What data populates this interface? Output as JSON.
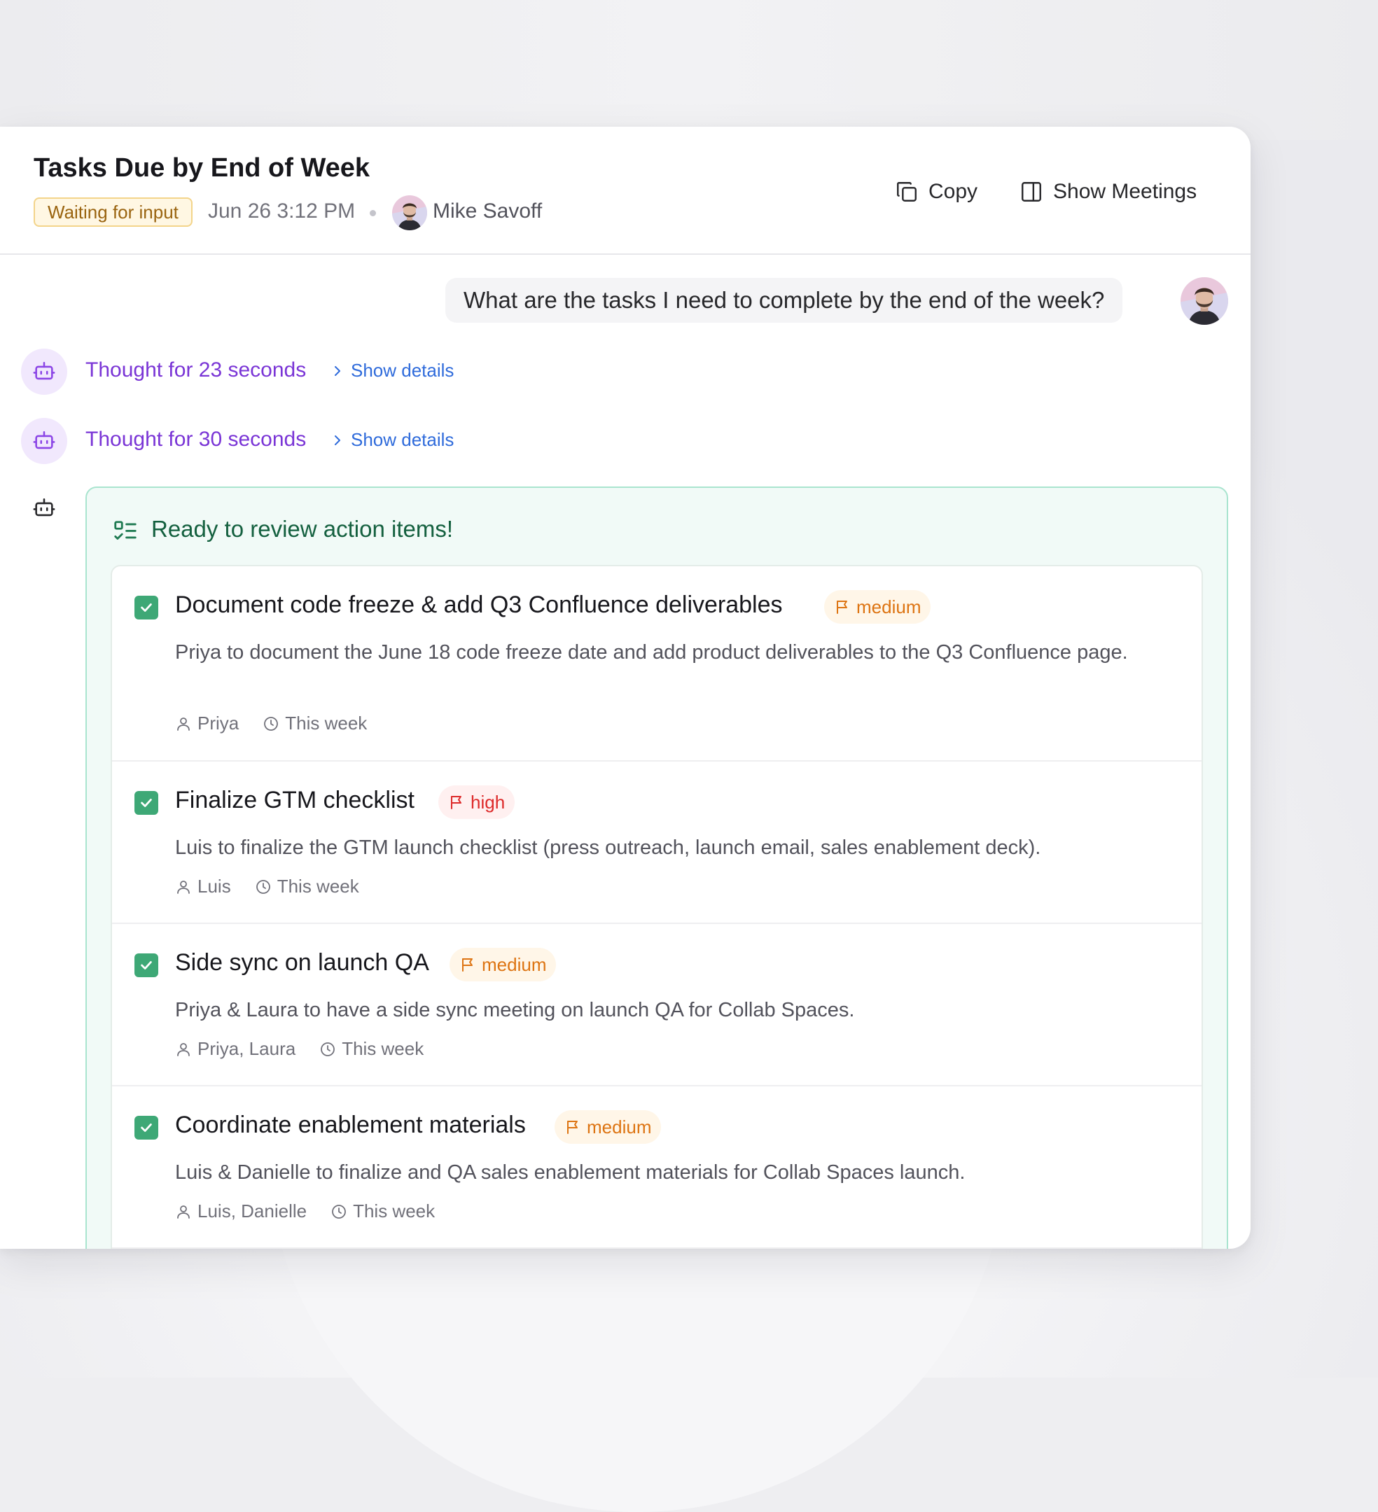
{
  "header": {
    "title": "Tasks Due by End of Week",
    "status": "Waiting for input",
    "date": "Jun 26 3:12 PM",
    "user_name": "Mike Savoff",
    "copy_label": "Copy",
    "show_meetings_label": "Show Meetings"
  },
  "conversation": {
    "user_message": "What are the tasks I need to complete by the end of the week?",
    "thoughts": [
      {
        "label": "Thought for 23 seconds",
        "link": "Show details"
      },
      {
        "label": "Thought for 30 seconds",
        "link": "Show details"
      }
    ]
  },
  "action_items": {
    "heading": "Ready to review action items!",
    "items": [
      {
        "title": "Document code freeze & add Q3 Confluence deliverables",
        "priority": "medium",
        "description": "Priya to document the June 18 code freeze date and add product deliverables to the Q3 Confluence page.",
        "assignees": "Priya",
        "due": "This week",
        "checked": true
      },
      {
        "title": "Finalize GTM checklist",
        "priority": "high",
        "description": "Luis to finalize the GTM launch checklist (press outreach, launch email, sales enablement deck).",
        "assignees": "Luis",
        "due": "This week",
        "checked": true
      },
      {
        "title": "Side sync on launch QA",
        "priority": "medium",
        "description": "Priya & Laura to have a side sync meeting on launch QA for Collab Spaces.",
        "assignees": "Priya, Laura",
        "due": "This week",
        "checked": true
      },
      {
        "title": "Coordinate enablement materials",
        "priority": "medium",
        "description": "Luis & Danielle to finalize and QA sales enablement materials for Collab Spaces launch.",
        "assignees": "Luis, Danielle",
        "due": "This week",
        "checked": true
      }
    ]
  },
  "colors": {
    "accent_purple": "#7a35d6",
    "link_blue": "#2f6bdb",
    "success_green": "#3ea876",
    "priority_medium": "#dd7412",
    "priority_high": "#dd2a2a",
    "status_amber": "#9a6410"
  },
  "icons": {
    "copy": "copy-icon",
    "meetings": "sidebar-panel-icon",
    "bot": "robot-icon",
    "checklist": "checklist-icon",
    "flag": "flag-icon",
    "user": "user-icon",
    "clock": "clock-icon",
    "check": "check-icon",
    "chevron": "chevron-right-icon"
  }
}
